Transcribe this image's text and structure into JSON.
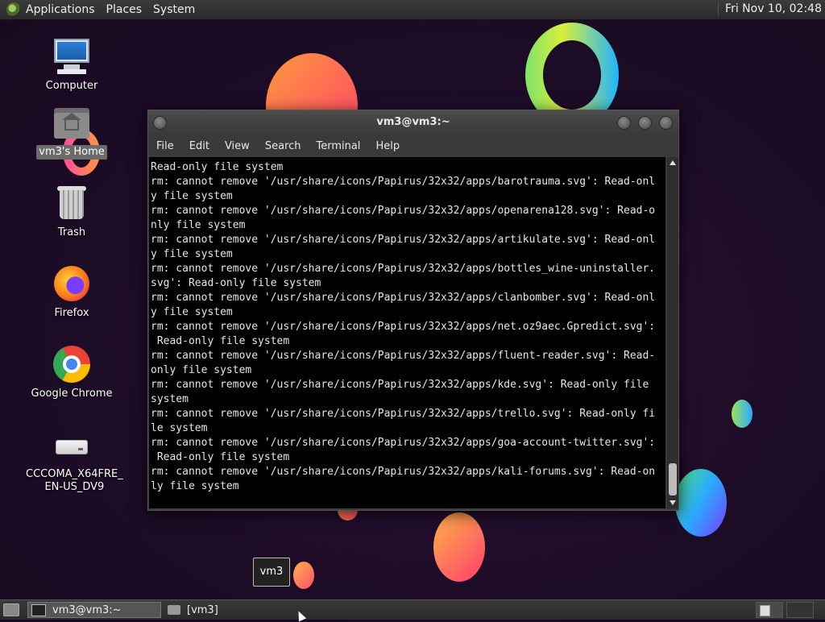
{
  "top_panel": {
    "menus": [
      "Applications",
      "Places",
      "System"
    ],
    "clock": "Fri Nov 10, 02:48"
  },
  "desktop_icons": [
    {
      "label": "Computer",
      "icon": "computer-icon"
    },
    {
      "label": "vm3's Home",
      "icon": "home-folder-icon"
    },
    {
      "label": "Trash",
      "icon": "trash-icon"
    },
    {
      "label": "Firefox",
      "icon": "firefox-icon"
    },
    {
      "label": "Google Chrome",
      "icon": "chrome-icon"
    },
    {
      "label_line1": "CCCOMA_X64FRE_",
      "label_line2": "EN-US_DV9",
      "icon": "drive-icon"
    }
  ],
  "terminal": {
    "title": "vm3@vm3:~",
    "menu": [
      "File",
      "Edit",
      "View",
      "Search",
      "Terminal",
      "Help"
    ],
    "lines": [
      "Read-only file system",
      "rm: cannot remove '/usr/share/icons/Papirus/32x32/apps/barotrauma.svg': Read-onl",
      "y file system",
      "rm: cannot remove '/usr/share/icons/Papirus/32x32/apps/openarena128.svg': Read-o",
      "nly file system",
      "rm: cannot remove '/usr/share/icons/Papirus/32x32/apps/artikulate.svg': Read-onl",
      "y file system",
      "rm: cannot remove '/usr/share/icons/Papirus/32x32/apps/bottles_wine-uninstaller.",
      "svg': Read-only file system",
      "rm: cannot remove '/usr/share/icons/Papirus/32x32/apps/clanbomber.svg': Read-onl",
      "y file system",
      "rm: cannot remove '/usr/share/icons/Papirus/32x32/apps/net.oz9aec.Gpredict.svg':",
      " Read-only file system",
      "rm: cannot remove '/usr/share/icons/Papirus/32x32/apps/fluent-reader.svg': Read-",
      "only file system",
      "rm: cannot remove '/usr/share/icons/Papirus/32x32/apps/kde.svg': Read-only file",
      "system",
      "rm: cannot remove '/usr/share/icons/Papirus/32x32/apps/trello.svg': Read-only fi",
      "le system",
      "rm: cannot remove '/usr/share/icons/Papirus/32x32/apps/goa-account-twitter.svg':",
      " Read-only file system",
      "rm: cannot remove '/usr/share/icons/Papirus/32x32/apps/kali-forums.svg': Read-on",
      "ly file system"
    ]
  },
  "workspace_tooltip": "vm3",
  "bottom_panel": {
    "tasks": [
      {
        "label": "vm3@vm3:~",
        "active": true
      },
      {
        "label": "[vm3]",
        "active": false
      }
    ]
  }
}
